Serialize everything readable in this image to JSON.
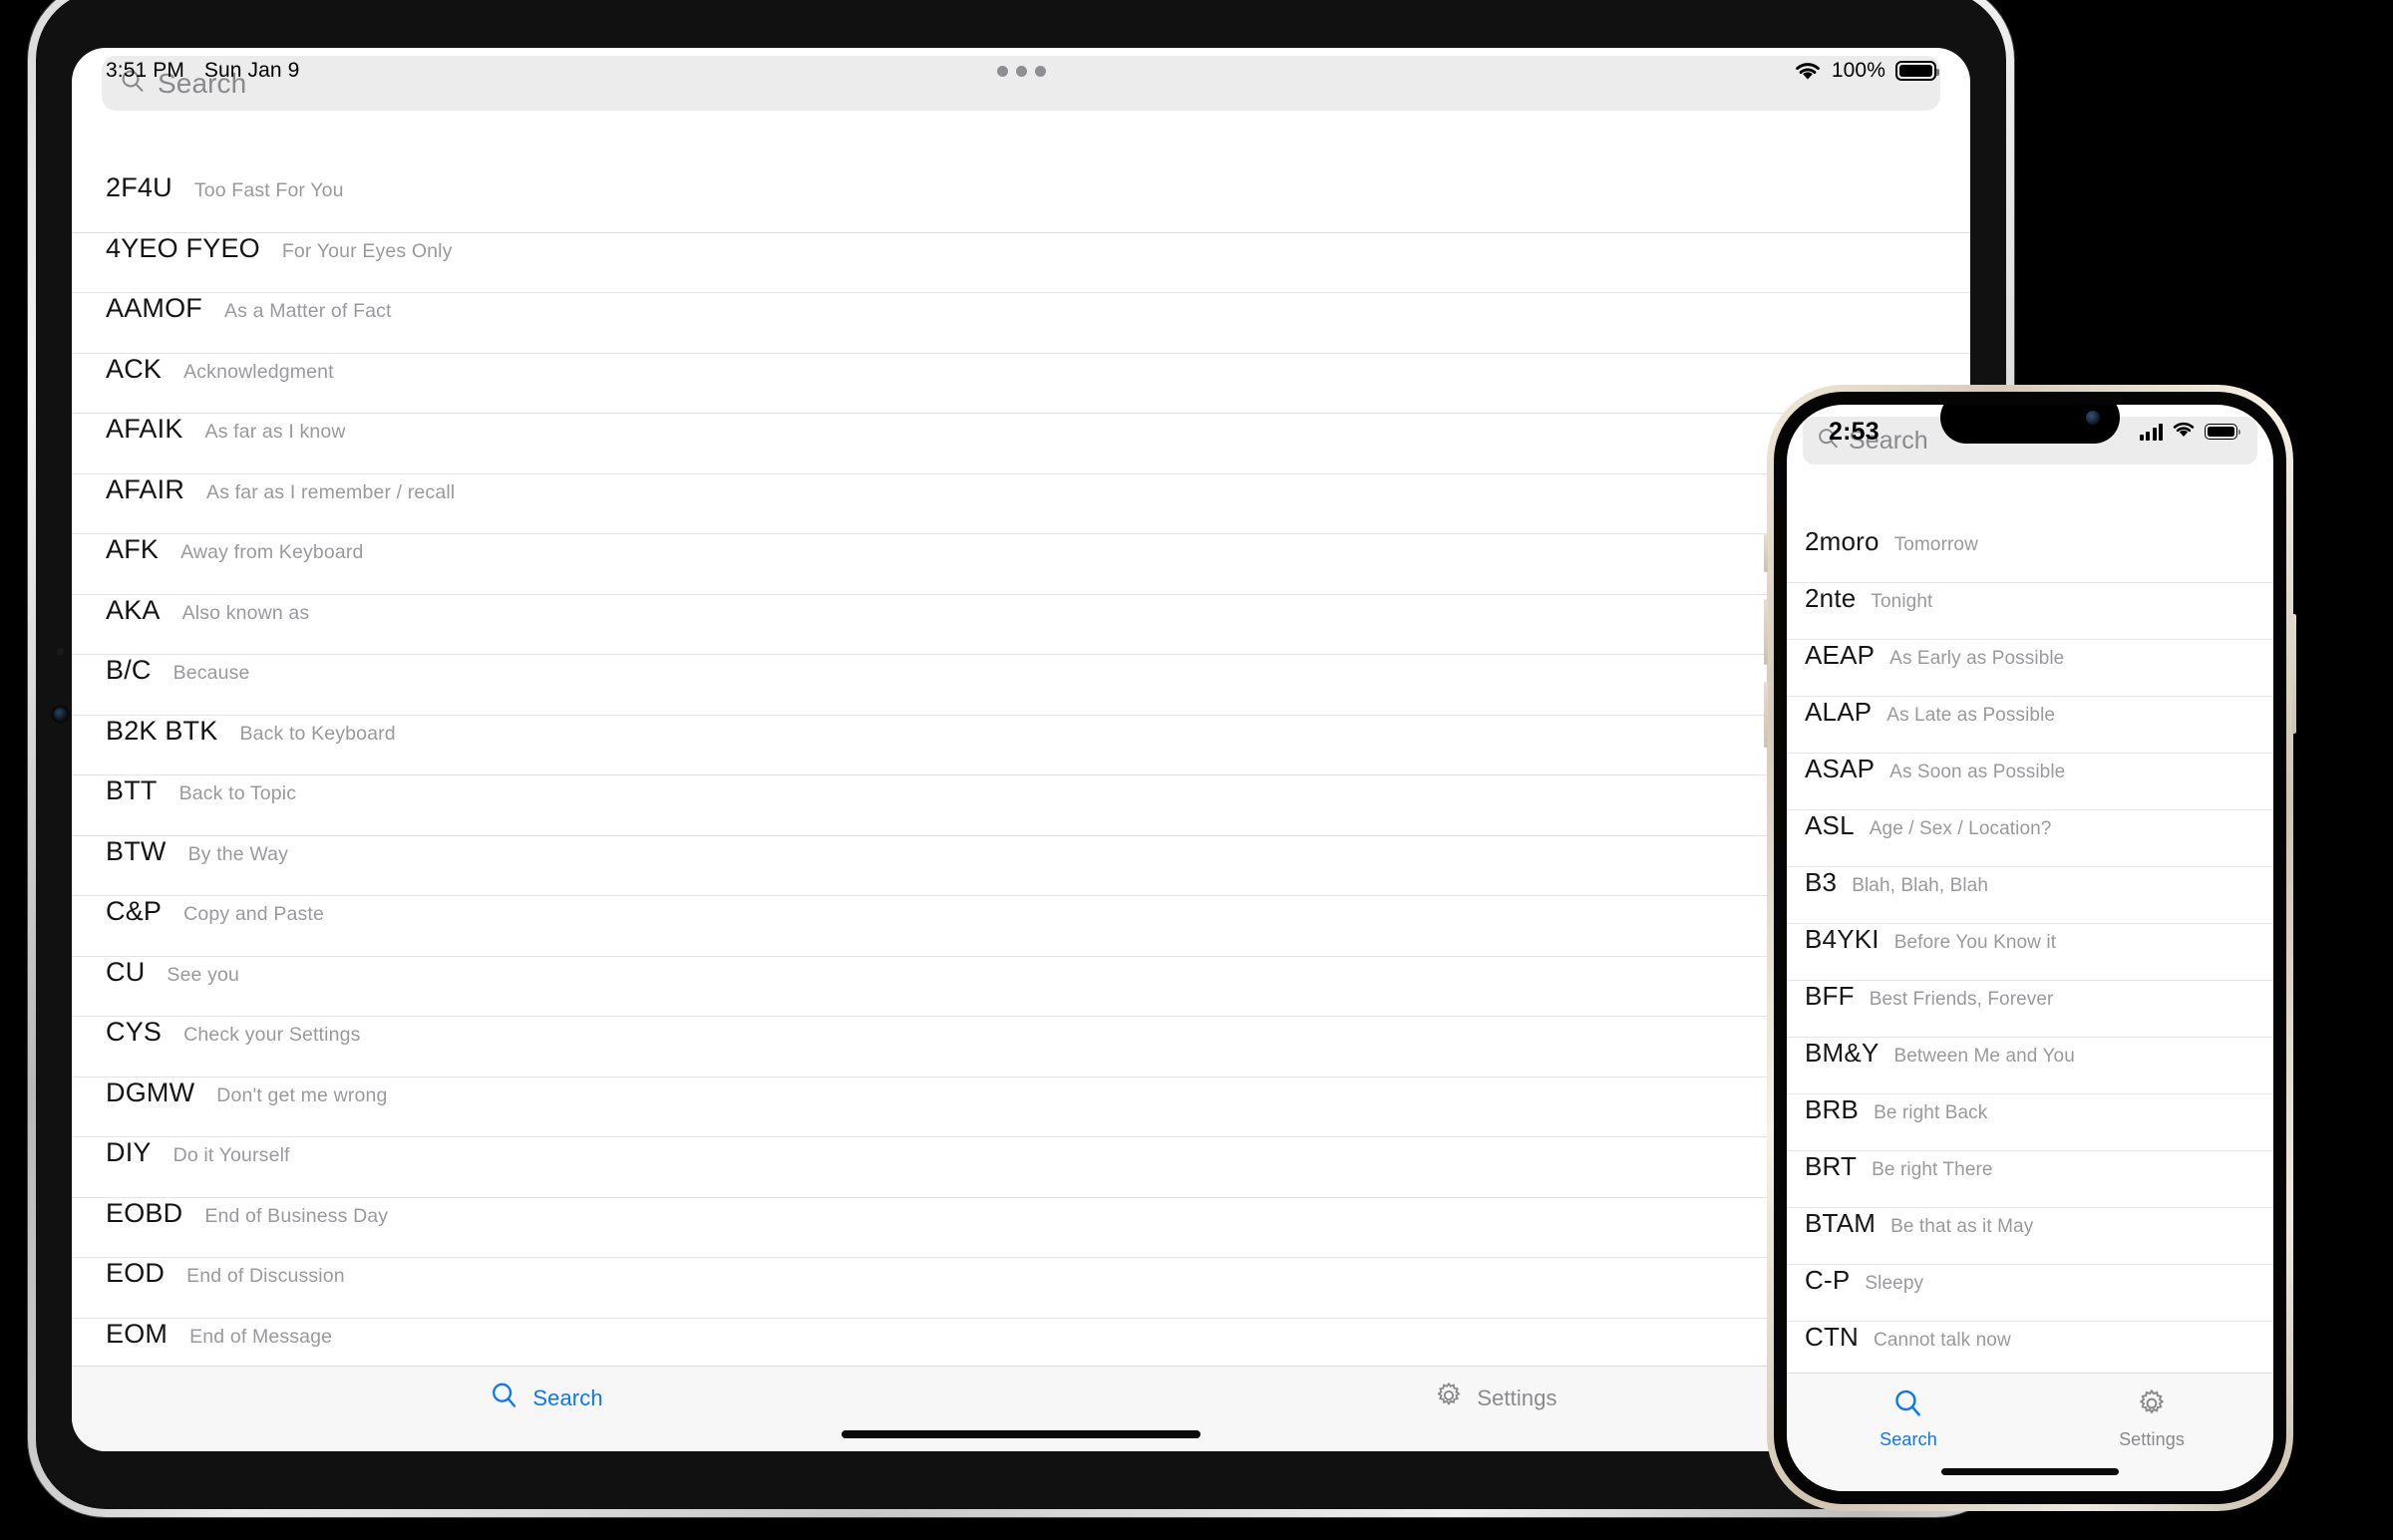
{
  "ipad": {
    "status": {
      "time": "3:51 PM",
      "date": "Sun Jan 9",
      "battery_percent": "100%",
      "wifi_icon": "wifi-icon",
      "battery_icon": "battery-full-icon",
      "multitask_icon": "multitasking-dots-icon"
    },
    "search": {
      "placeholder": "Search",
      "icon": "search-icon",
      "value": ""
    },
    "list": [
      {
        "abbr": "2F4U",
        "meaning": "Too Fast For You"
      },
      {
        "abbr": "4YEO FYEO",
        "meaning": "For Your Eyes Only"
      },
      {
        "abbr": "AAMOF",
        "meaning": "As a Matter of Fact"
      },
      {
        "abbr": "ACK",
        "meaning": "Acknowledgment"
      },
      {
        "abbr": "AFAIK",
        "meaning": "As far as I know"
      },
      {
        "abbr": "AFAIR",
        "meaning": "As far as I remember / recall"
      },
      {
        "abbr": "AFK",
        "meaning": "Away from Keyboard"
      },
      {
        "abbr": "AKA",
        "meaning": "Also known as"
      },
      {
        "abbr": "B/C",
        "meaning": "Because"
      },
      {
        "abbr": "B2K BTK",
        "meaning": "Back to Keyboard"
      },
      {
        "abbr": "BTT",
        "meaning": "Back to Topic"
      },
      {
        "abbr": "BTW",
        "meaning": "By the Way"
      },
      {
        "abbr": "C&P",
        "meaning": "Copy and Paste"
      },
      {
        "abbr": "CU",
        "meaning": "See you"
      },
      {
        "abbr": "CYS",
        "meaning": "Check your Settings"
      },
      {
        "abbr": "DGMW",
        "meaning": "Don't get me wrong"
      },
      {
        "abbr": "DIY",
        "meaning": "Do it Yourself"
      },
      {
        "abbr": "EOBD",
        "meaning": "End of Business Day"
      },
      {
        "abbr": "EOD",
        "meaning": "End of Discussion"
      },
      {
        "abbr": "EOM",
        "meaning": "End of Message"
      }
    ],
    "tabs": [
      {
        "label": "Search",
        "icon": "search-icon",
        "active": true
      },
      {
        "label": "Settings",
        "icon": "gear-icon",
        "active": false
      }
    ]
  },
  "iphone": {
    "status": {
      "time": "2:53",
      "cellular_icon": "cellular-bars-icon",
      "wifi_icon": "wifi-icon",
      "battery_icon": "battery-full-icon"
    },
    "search": {
      "placeholder": "Search",
      "icon": "search-icon",
      "value": ""
    },
    "list": [
      {
        "abbr": "2moro",
        "meaning": "Tomorrow"
      },
      {
        "abbr": "2nte",
        "meaning": "Tonight"
      },
      {
        "abbr": "AEAP",
        "meaning": "As Early as Possible"
      },
      {
        "abbr": "ALAP",
        "meaning": "As Late as Possible"
      },
      {
        "abbr": "ASAP",
        "meaning": "As Soon as Possible"
      },
      {
        "abbr": "ASL",
        "meaning": "Age / Sex / Location?"
      },
      {
        "abbr": "B3",
        "meaning": "Blah, Blah, Blah"
      },
      {
        "abbr": "B4YKI",
        "meaning": "Before You Know it"
      },
      {
        "abbr": "BFF",
        "meaning": "Best Friends, Forever"
      },
      {
        "abbr": "BM&Y",
        "meaning": "Between Me and You"
      },
      {
        "abbr": "BRB",
        "meaning": "Be right Back"
      },
      {
        "abbr": "BRT",
        "meaning": "Be right There"
      },
      {
        "abbr": "BTAM",
        "meaning": "Be that as it May"
      },
      {
        "abbr": "C-P",
        "meaning": "Sleepy"
      },
      {
        "abbr": "CTN",
        "meaning": "Cannot talk now"
      }
    ],
    "tabs": [
      {
        "label": "Search",
        "icon": "search-icon",
        "active": true
      },
      {
        "label": "Settings",
        "icon": "gear-icon",
        "active": false
      }
    ]
  },
  "colors": {
    "accent": "#0a78f5",
    "inactive": "#8a8a8e",
    "separator": "#e3e3e3",
    "search_field_bg": "#ececec",
    "tabbar_bg": "#f7f7f7"
  }
}
